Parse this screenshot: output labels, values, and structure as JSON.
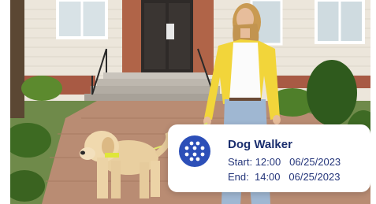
{
  "photo": {
    "subject": "woman-walking-dog"
  },
  "schedule_card": {
    "icon": "dots-grid-icon",
    "accent_color": "#2c4fb8",
    "title": "Dog Walker",
    "start_label": "Start:",
    "start_time": "12:00",
    "start_date": "06/25/2023",
    "end_label": "End:",
    "end_time": "14:00",
    "end_date": "06/25/2023"
  }
}
